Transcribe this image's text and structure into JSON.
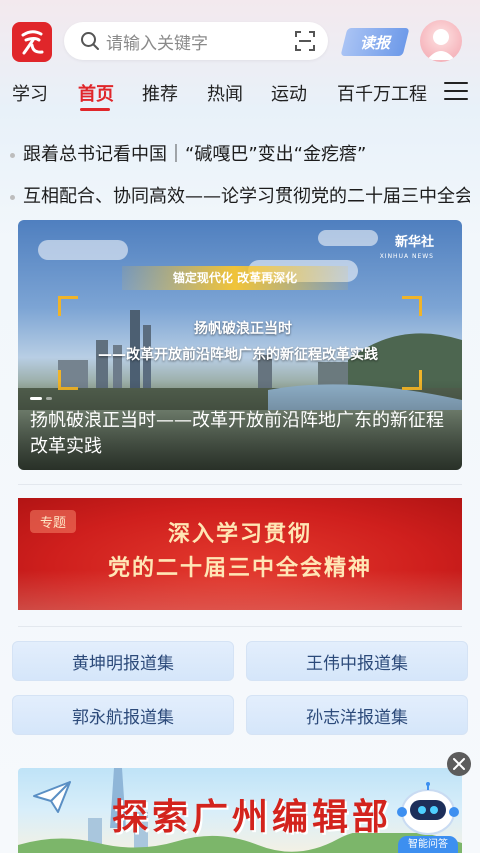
{
  "header": {
    "search_placeholder": "请输入关键字",
    "read_button": "读报"
  },
  "tabs": [
    {
      "label": "学习"
    },
    {
      "label": "首页"
    },
    {
      "label": "推荐"
    },
    {
      "label": "热闻"
    },
    {
      "label": "运动"
    },
    {
      "label": "百千万工程"
    }
  ],
  "active_tab": "首页",
  "headlines": [
    "跟着总书记看中国｜“碱嘎巴”变出“金疙瘩”",
    "互相配合、协同高效——论学习贯彻党的二十届三中全会精神"
  ],
  "hero": {
    "overline": "锚定现代化 改革再深化",
    "title_line1": "扬帆破浪正当时",
    "title_line2": "——改革开放前沿阵地广东的新征程改革实践",
    "watermark": "新华社",
    "watermark_en": "XINHUA NEWS",
    "caption": "扬帆破浪正当时——改革开放前沿阵地广东的新征程改革实践"
  },
  "topic_banner": {
    "tag": "专题",
    "line1": "深入学习贯彻",
    "line2": "党的二十届三中全会精神"
  },
  "report_links": [
    {
      "label": "黄坤明报道集"
    },
    {
      "label": "王伟中报道集"
    },
    {
      "label": "郭永航报道集"
    },
    {
      "label": "孙志洋报道集"
    }
  ],
  "bottom_banner": {
    "title": "探索广州编辑部"
  },
  "assistant": {
    "label": "智能问答"
  },
  "colors": {
    "brand_red": "#e0262a",
    "read_button_blue": "#6e9ae9",
    "report_text": "#2c4a7a"
  }
}
